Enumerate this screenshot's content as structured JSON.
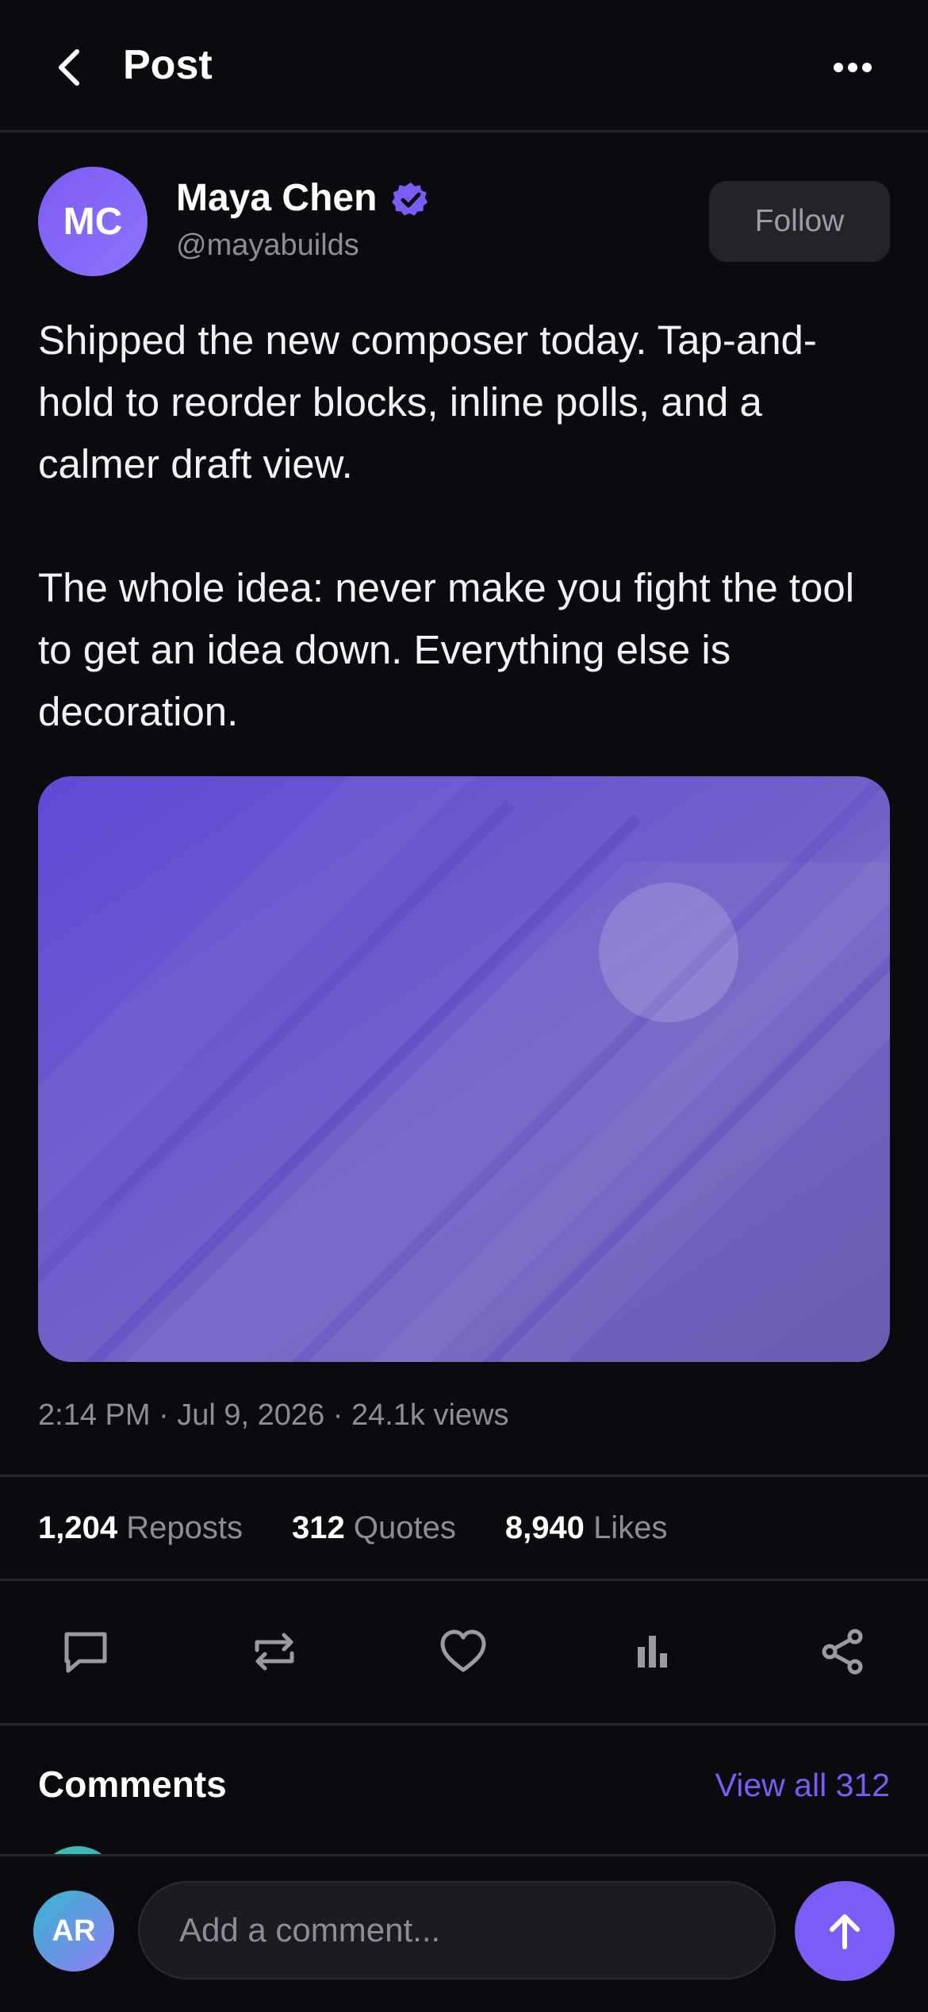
{
  "header": {
    "title": "Post",
    "back_icon": "chevron-left-icon",
    "more_icon": "more-horizontal-icon"
  },
  "author": {
    "initials": "MC",
    "name": "Maya Chen",
    "handle": "@mayabuilds",
    "verified_icon": "verified-badge-icon",
    "follow_label": "Follow"
  },
  "post": {
    "paragraphs": [
      "Shipped the new composer today. Tap-and-hold to reorder blocks, inline polls, and a calmer draft view.",
      "The whole idea: never make you fight the tool to get an idea down. Everything else is decoration."
    ],
    "meta": "2:14 PM · Jul 9, 2026 · 24.1k views"
  },
  "stats": [
    {
      "count": "1,204",
      "label": "Reposts"
    },
    {
      "count": "312",
      "label": "Quotes"
    },
    {
      "count": "8,940",
      "label": "Likes"
    }
  ],
  "actions": [
    "comment-icon",
    "repost-icon",
    "like-icon",
    "analytics-icon",
    "share-icon"
  ],
  "comments": {
    "title": "Comments",
    "view_all": "View all 312"
  },
  "composer": {
    "avatar_initials": "AR",
    "placeholder": "Add a comment...",
    "send_icon": "arrow-up-icon"
  },
  "colors": {
    "accent": "#7b5cf5",
    "background": "#0b0b0f",
    "muted": "#8d8d96"
  }
}
